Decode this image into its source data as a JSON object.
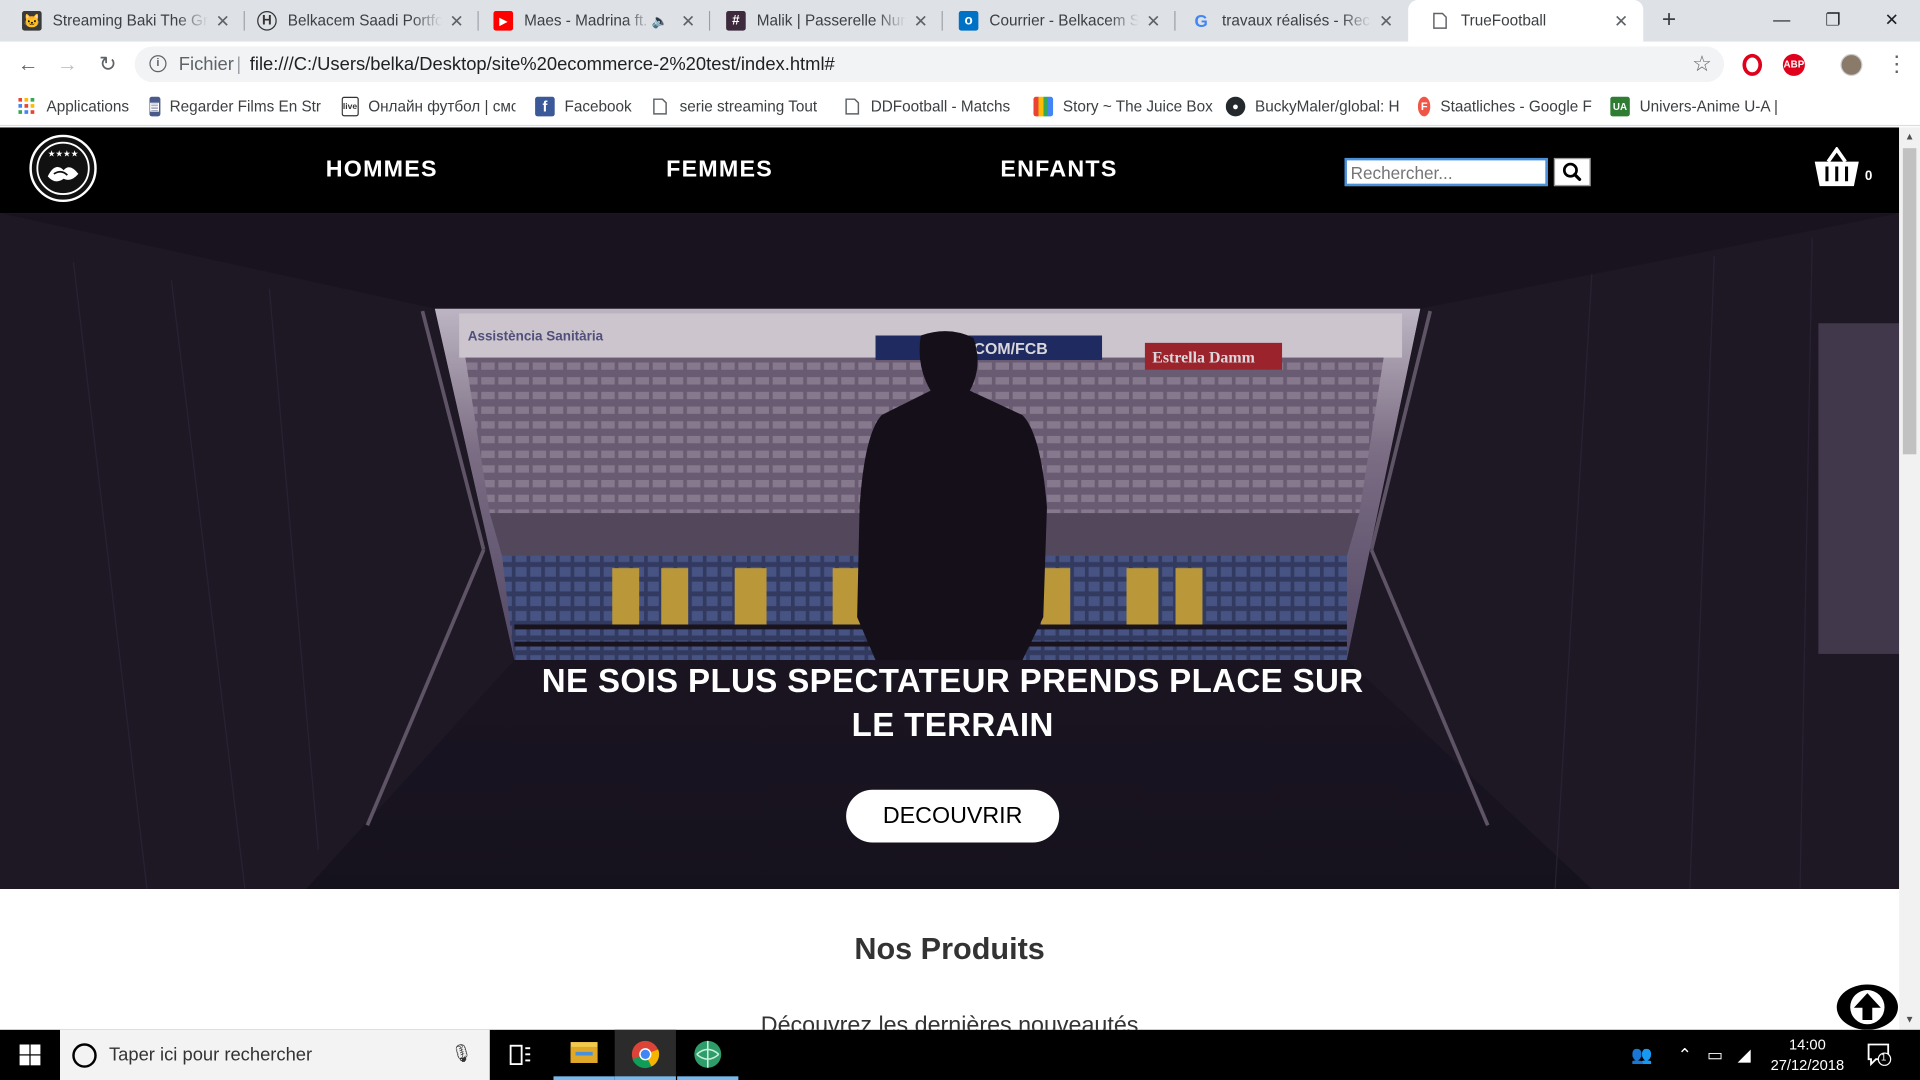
{
  "browser": {
    "tabs": [
      {
        "title": "Streaming Baki The Gra",
        "icon": "cat-favicon-icon",
        "active": false
      },
      {
        "title": "Belkacem Saadi Portfoli",
        "icon": "portfolio-favicon-icon",
        "active": false
      },
      {
        "title": "Maes - Madrina ft.",
        "icon": "youtube-favicon-icon",
        "active": false,
        "audio": true
      },
      {
        "title": "Malik | Passerelle Num",
        "icon": "hash-favicon-icon",
        "active": false
      },
      {
        "title": "Courrier - Belkacem Sa",
        "icon": "outlook-favicon-icon",
        "active": false
      },
      {
        "title": "travaux réalisés - Reche",
        "icon": "google-favicon-icon",
        "active": false
      },
      {
        "title": "TrueFootball",
        "icon": "page-favicon-icon",
        "active": true
      }
    ],
    "address": {
      "scheme_label": "Fichier",
      "url": "file:///C:/Users/belka/Desktop/site%20ecommerce-2%20test/index.html#"
    },
    "bookmarks": [
      {
        "label": "Applications",
        "icon": "apps-grid-icon"
      },
      {
        "label": "Regarder Films En Str",
        "icon": "film-bookmark-icon"
      },
      {
        "label": "Онлайн футбол | смс",
        "icon": "live-bookmark-icon"
      },
      {
        "label": "Facebook",
        "icon": "facebook-icon"
      },
      {
        "label": "serie streaming Tout",
        "icon": "page-icon"
      },
      {
        "label": "DDFootball - Matchs",
        "icon": "page-icon"
      },
      {
        "label": "Story ~ The Juice Box",
        "icon": "colorful-bookmark-icon"
      },
      {
        "label": "BuckyMaler/global: H",
        "icon": "github-icon"
      },
      {
        "label": "Staatliches - Google F",
        "icon": "google-fonts-icon"
      },
      {
        "label": "Univers-Anime U-A |",
        "icon": "ua-bookmark-icon"
      }
    ]
  },
  "site": {
    "nav": {
      "links": [
        "HOMMES",
        "FEMMES",
        "ENFANTS"
      ],
      "search_placeholder": "Rechercher...",
      "cart_count": "0"
    },
    "hero": {
      "title_line1": "NE SOIS PLUS SPECTATEUR PRENDS PLACE SUR",
      "title_line2": "LE TERRAIN",
      "cta": "DECOUVRIR",
      "banners": {
        "left": "Assistència Sanitària",
        "center": "COM/FCB",
        "right": "Estrella Damm"
      }
    },
    "products": {
      "title": "Nos Produits",
      "subtitle": "Découvrez les dernières nouveautés"
    }
  },
  "taskbar": {
    "search_placeholder": "Taper ici pour rechercher",
    "time": "14:00",
    "date": "27/12/2018",
    "notification_count": "1"
  },
  "colors": {
    "tabstrip": "#dee1e6",
    "site_nav": "#000000",
    "hero_tint": "#2a2135",
    "taskbar": "#000000",
    "youtube": "#ff0000",
    "outlook": "#0072c6"
  }
}
